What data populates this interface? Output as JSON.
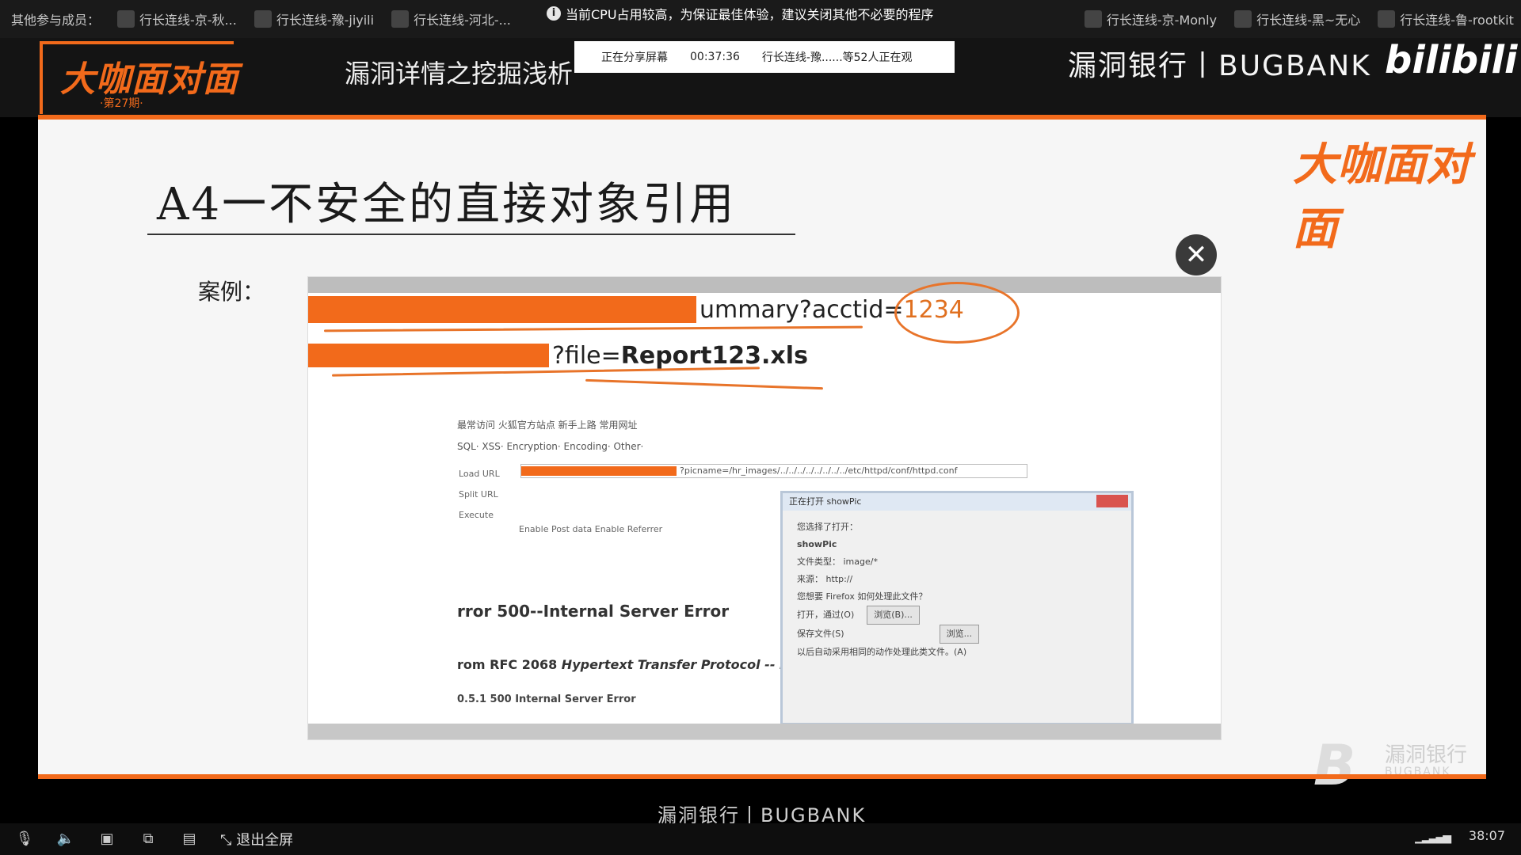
{
  "participants_bar": {
    "label": "其他参与成员：",
    "members": [
      "行长连线-京-秋...",
      "行长连线-豫-jiyili",
      "行长连线-河北-...",
      "行长连线-京-Monly",
      "行长连线-黑~无心",
      "行长连线-鲁-rootkit"
    ]
  },
  "notice": "当前CPU占用较高，为保证最佳体验，建议关闭其他不必要的程序",
  "share": {
    "status": "正在分享屏幕",
    "timer": "00:37:36",
    "viewers": "行长连线-豫......等52人正在观"
  },
  "header": {
    "logo": "大咖面对面",
    "issue": "·第27期·",
    "title": "漏洞详情之挖掘浅析",
    "brand": "漏洞银行丨BUGBANK",
    "platform_logo": "bilibili"
  },
  "slide": {
    "logo": "大咖面对面",
    "title": "A4一不安全的直接对象引用",
    "case_label": "案例：",
    "url_line1": "ummary?acctid=",
    "url_line1_value": "1234",
    "url_line2": "?file=",
    "url_line2_value": "Report123.xls",
    "toolbar_row1": "最常访问  火狐官方站点  新手上路  常用网址",
    "toolbar_row2": "SQL·  XSS·  Encryption·  Encoding·  Other·",
    "inner_url": "?picname=/hr_images/../../../../../../../../etc/httpd/conf/httpd.conf",
    "side_labels": [
      "Load URL",
      "Split URL",
      "Execute"
    ],
    "checkboxes": "Enable Post data   Enable Referrer",
    "error_title": "rror 500--Internal Server Error",
    "error_rfc_prefix": "rom RFC 2068 ",
    "error_rfc_italic": "Hypertext Transfer Protocol -- HT",
    "error_code": "0.5.1 500 Internal Server Error",
    "dialog": {
      "title": "正在打开 showPic",
      "line1": "您选择了打开：",
      "filename": "showPic",
      "filetype": "文件类型：  image/*",
      "source": "来源：  http://",
      "question": "您想要 Firefox 如何处理此文件？",
      "open_with": "打开，通过(O)",
      "browse": "浏览(B)...",
      "save_file": "保存文件(S)",
      "other_btn": "浏览...",
      "remember": "以后自动采用相同的动作处理此类文件。(A)"
    },
    "watermark_name": "漏洞银行",
    "watermark_sub": "BUGBANK"
  },
  "footer": {
    "brand": "漏洞银行丨BUGBANK",
    "exit_fullscreen": "退出全屏",
    "clock": "38:07"
  },
  "colors": {
    "accent": "#f26a1b",
    "background": "#000000",
    "slide": "#f6f6f6"
  }
}
